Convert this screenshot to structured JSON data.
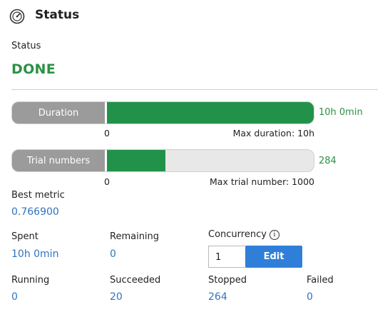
{
  "header": {
    "title": "Status",
    "icon": "gauge-icon"
  },
  "status": {
    "label": "Status",
    "value": "DONE",
    "color": "#2b9145"
  },
  "duration_bar": {
    "label": "Duration",
    "value_text": "10h 0min",
    "min_text": "0",
    "max_text": "Max duration: 10h",
    "fraction": 1.0,
    "fill_color": "#22924a",
    "value_color": "#2b9145"
  },
  "trial_bar": {
    "label": "Trial numbers",
    "value_text": "284",
    "min_text": "0",
    "max_text": "Max trial number: 1000",
    "fraction": 0.284,
    "fill_color": "#22924a",
    "value_color": "#2b9145"
  },
  "best_metric": {
    "label": "Best metric",
    "value": "0.766900"
  },
  "spent": {
    "label": "Spent",
    "value": "10h 0min"
  },
  "remaining": {
    "label": "Remaining",
    "value": "0"
  },
  "concurrency": {
    "label": "Concurrency",
    "info_icon": "info-icon",
    "value": "1",
    "edit_label": "Edit"
  },
  "running": {
    "label": "Running",
    "value": "0"
  },
  "succeeded": {
    "label": "Succeeded",
    "value": "20"
  },
  "stopped": {
    "label": "Stopped",
    "value": "264"
  },
  "failed": {
    "label": "Failed",
    "value": "0"
  },
  "colors": {
    "link": "#2f74c0",
    "button": "#2f7fd9",
    "bar_label_bg": "#9b9b9b"
  }
}
